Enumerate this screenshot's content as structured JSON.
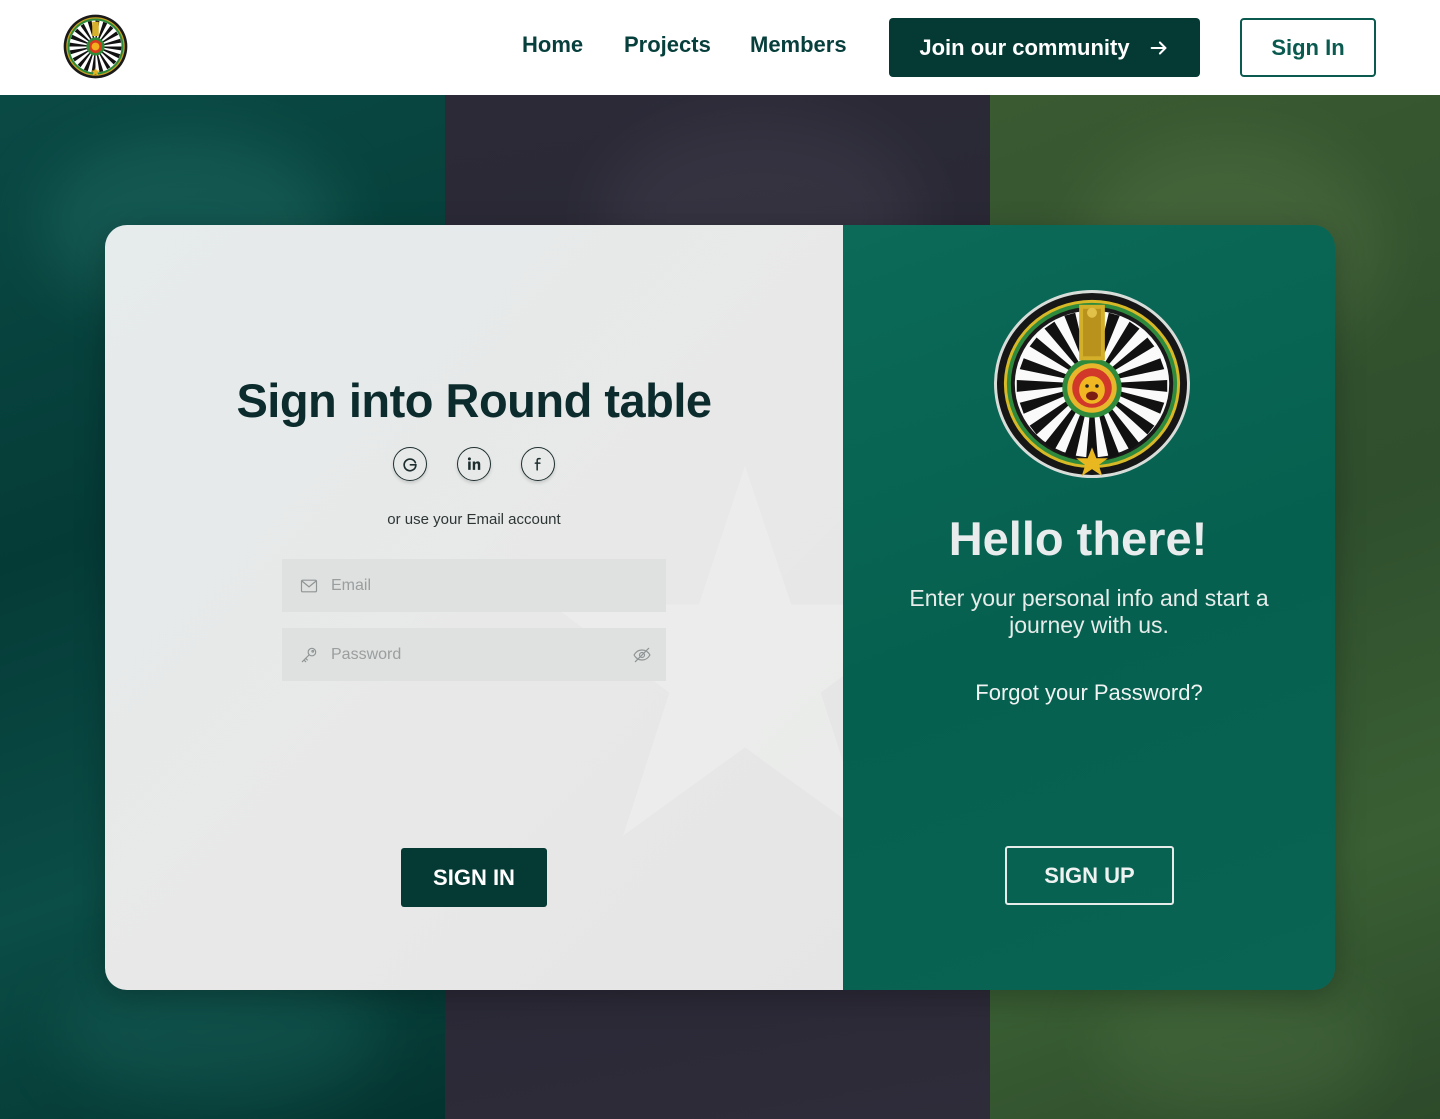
{
  "header": {
    "logo_icon": "round-table-emblem",
    "nav": [
      {
        "label": "Home"
      },
      {
        "label": "Projects"
      },
      {
        "label": "Members"
      }
    ],
    "join_button": {
      "label": "Join our community",
      "icon": "arrow-right-icon"
    },
    "signin_button": {
      "label": "Sign In"
    }
  },
  "sign_in_panel": {
    "title": "Sign into Round table",
    "social_icons": [
      "google-icon",
      "linkedin-icon",
      "facebook-icon"
    ],
    "alt_text": "or use your Email account",
    "email": {
      "placeholder": "Email",
      "value": "",
      "icon": "mail-icon"
    },
    "password": {
      "placeholder": "Password",
      "value": "",
      "icon": "key-icon",
      "toggle_icon": "eye-off-icon"
    },
    "submit_label": "SIGN IN"
  },
  "welcome_panel": {
    "emblem_icon": "round-table-emblem",
    "heading": "Hello there!",
    "subtext": "Enter your personal info and start a journey with us.",
    "forgot_link": "Forgot your Password?",
    "signup_label": "SIGN UP"
  },
  "colors": {
    "primary_dark": "#043a33",
    "primary_teal": "#0a5a50",
    "panel_green": "#06604f",
    "flag_green": "#0a4a45",
    "flag_dark": "#2c2a37",
    "flag_olive": "#3a5a32"
  }
}
